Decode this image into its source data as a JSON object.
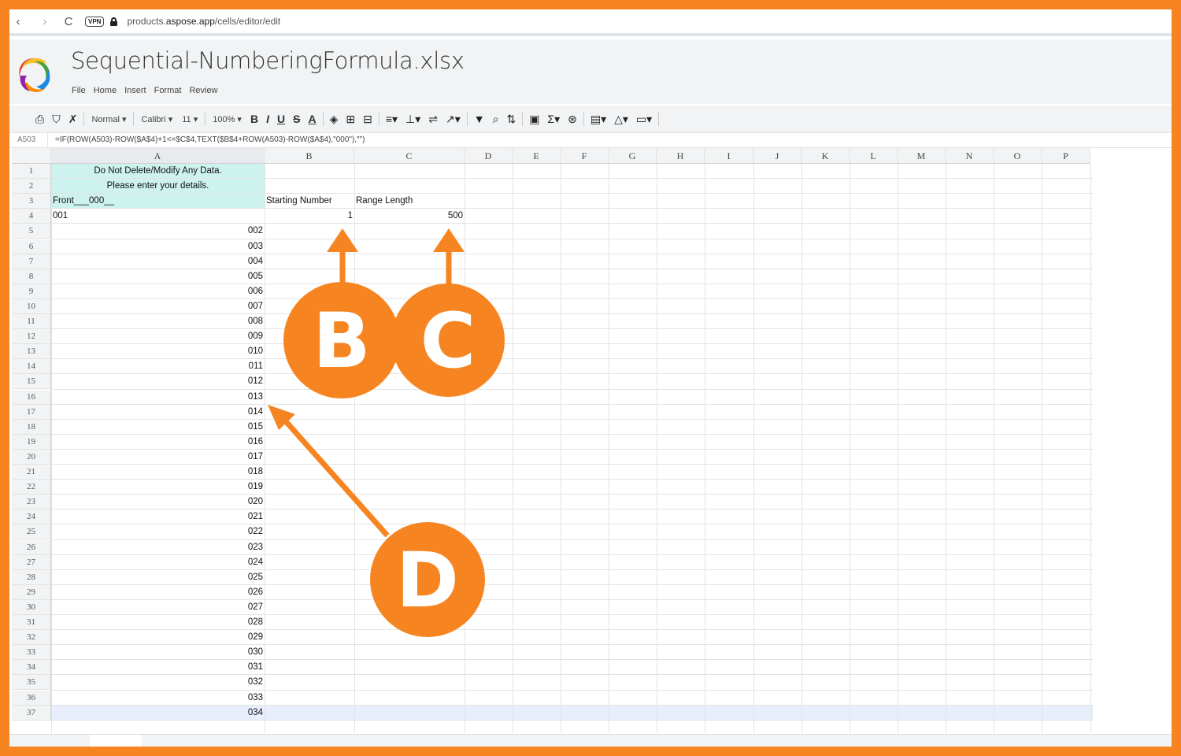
{
  "browser": {
    "back": "‹",
    "forward": "›",
    "reload": "C",
    "vpn": "VPN",
    "url_prefix": "products.",
    "url_domain": "aspose.app",
    "url_path": "/cells/editor/edit"
  },
  "app": {
    "file_title": "Sequential-NumberingFormula.xlsx",
    "menu": [
      "File",
      "Home",
      "Insert",
      "Format",
      "Review"
    ]
  },
  "toolbar": {
    "style": "Normal",
    "font": "Calibri",
    "size": "11",
    "zoom": "100%"
  },
  "formula_bar": {
    "cell_ref": "A503",
    "formula": "=IF(ROW(A503)-ROW($A$4)+1<=$C$4,TEXT($B$4+ROW(A503)-ROW($A$4),\"000\"),\"\")"
  },
  "sheet": {
    "columns": [
      "A",
      "B",
      "C",
      "D",
      "E",
      "F",
      "G",
      "H",
      "I",
      "J",
      "K",
      "L",
      "M",
      "N",
      "O",
      "P"
    ],
    "rows": [
      "1",
      "2",
      "3",
      "4",
      "5",
      "6",
      "7",
      "8",
      "9",
      "10",
      "11",
      "12",
      "13",
      "14",
      "15",
      "16",
      "17",
      "18",
      "19",
      "20",
      "21",
      "22",
      "23",
      "24",
      "25",
      "26",
      "27",
      "28",
      "29",
      "30",
      "31",
      "32",
      "33",
      "34",
      "35",
      "36",
      "37"
    ],
    "a1": "Do Not Delete/Modify Any Data.",
    "a2": "Please enter your details.",
    "a3": "Front___000__",
    "b3": "Starting Number",
    "c3": "Range Length",
    "a4": "001",
    "b4": "1",
    "c4": "500",
    "a_values": [
      "002",
      "003",
      "004",
      "005",
      "006",
      "007",
      "008",
      "009",
      "010",
      "011",
      "012",
      "013",
      "014",
      "015",
      "016",
      "017",
      "018",
      "019",
      "020",
      "021",
      "022",
      "023",
      "024",
      "025",
      "026",
      "027",
      "028",
      "029",
      "030",
      "031",
      "032",
      "033",
      "034"
    ]
  },
  "annotations": {
    "label_b": "B",
    "label_c": "C",
    "label_d": "D",
    "color": "#f68521"
  }
}
